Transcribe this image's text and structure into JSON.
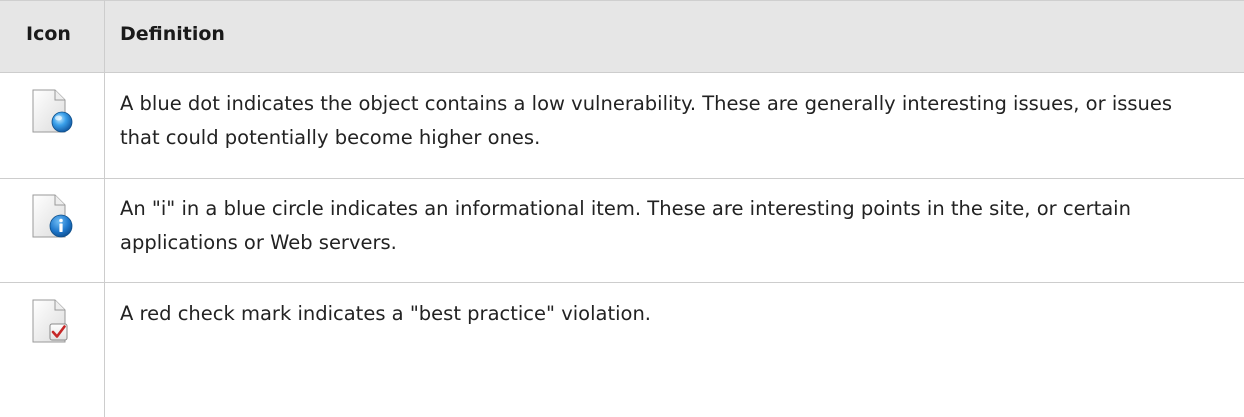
{
  "header": {
    "icon_label": "Icon",
    "definition_label": "Definition"
  },
  "rows": [
    {
      "icon": "document-blue-dot-icon",
      "definition": "A blue dot indicates the object contains a low vulnerability. These are generally interesting issues, or issues that could potentially become higher ones."
    },
    {
      "icon": "document-info-icon",
      "definition": "An \"i\" in a blue circle indicates an informational item. These are interesting points in the site, or certain applications or Web servers."
    },
    {
      "icon": "document-red-check-icon",
      "definition": "A red check mark indicates a \"best practice\" violation."
    }
  ],
  "colors": {
    "header_bg": "#e6e6e6",
    "grid_line": "#cdcdcd",
    "blue_dot": "#2f86d6",
    "check_red": "#c62828"
  }
}
